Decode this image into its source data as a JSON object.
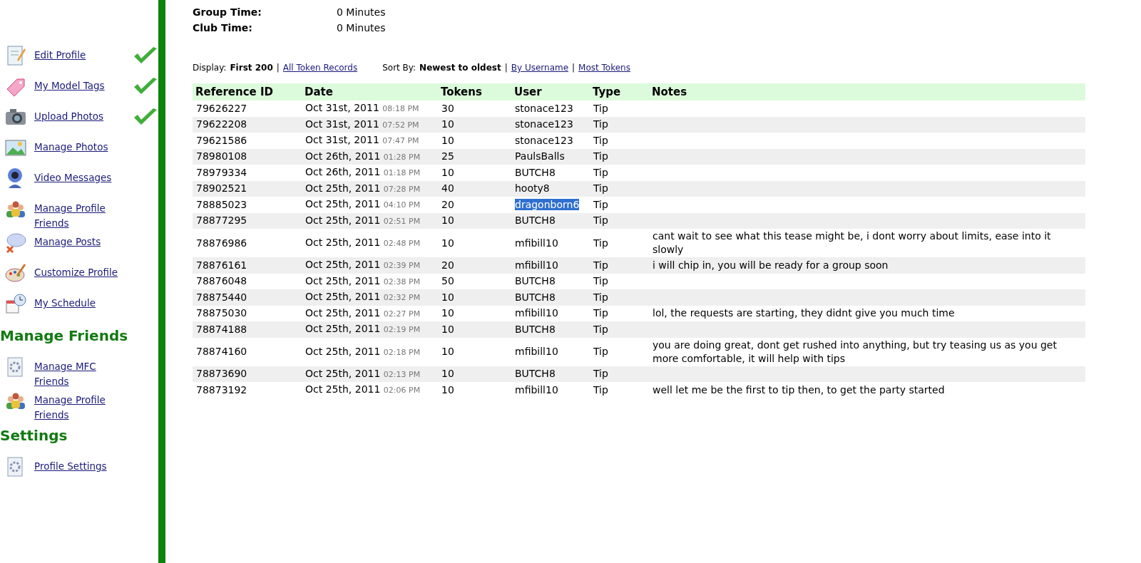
{
  "summary": [
    {
      "label": "Group Time:",
      "value": "0 Minutes"
    },
    {
      "label": "Club Time:",
      "value": "0 Minutes"
    }
  ],
  "sidebar": {
    "sections": [
      {
        "items": [
          {
            "label": "Edit Profile",
            "checked": true
          },
          {
            "label": "My Model Tags",
            "checked": true
          },
          {
            "label": "Upload Photos",
            "checked": true
          },
          {
            "label": "Manage Photos",
            "checked": false
          },
          {
            "label": "Video Messages",
            "checked": false
          },
          {
            "label": "Manage Profile Friends",
            "checked": false
          },
          {
            "label": "Manage Posts",
            "checked": false
          },
          {
            "label": "Customize Profile",
            "checked": false
          },
          {
            "label": "My Schedule",
            "checked": false
          }
        ]
      },
      {
        "heading": "Manage Friends",
        "items": [
          {
            "label": "Manage MFC Friends",
            "checked": false
          },
          {
            "label": "Manage Profile Friends",
            "checked": false
          }
        ]
      },
      {
        "heading": "Settings",
        "items": [
          {
            "label": "Profile Settings",
            "checked": false
          }
        ]
      }
    ]
  },
  "filters": {
    "separator": "|",
    "display_label": "Display:",
    "display_current": "First 200",
    "display_links": [
      "All Token Records"
    ],
    "sort_label": "Sort By:",
    "sort_current": "Newest to oldest",
    "sort_links": [
      "By Username",
      "Most Tokens"
    ]
  },
  "table": {
    "columns": [
      "Reference ID",
      "Date",
      "Tokens",
      "User",
      "Type",
      "Notes"
    ],
    "rows": [
      {
        "id": "79626227",
        "date": "Oct 31st, 2011",
        "time": "08:18 PM",
        "tokens": "30",
        "user": "stonace123",
        "type": "Tip",
        "selected": false
      },
      {
        "id": "79622208",
        "date": "Oct 31st, 2011",
        "time": "07:52 PM",
        "tokens": "10",
        "user": "stonace123",
        "type": "Tip",
        "selected": false
      },
      {
        "id": "79621586",
        "date": "Oct 31st, 2011",
        "time": "07:47 PM",
        "tokens": "10",
        "user": "stonace123",
        "type": "Tip",
        "selected": false
      },
      {
        "id": "78980108",
        "date": "Oct 26th, 2011",
        "time": "01:28 PM",
        "tokens": "25",
        "user": "PaulsBalls",
        "type": "Tip",
        "selected": false
      },
      {
        "id": "78979334",
        "date": "Oct 26th, 2011",
        "time": "01:18 PM",
        "tokens": "10",
        "user": "BUTCH8",
        "type": "Tip",
        "selected": false
      },
      {
        "id": "78902521",
        "date": "Oct 25th, 2011",
        "time": "07:28 PM",
        "tokens": "40",
        "user": "hooty8",
        "type": "Tip",
        "selected": false
      },
      {
        "id": "78885023",
        "date": "Oct 25th, 2011",
        "time": "04:10 PM",
        "tokens": "20",
        "user": "dragonborn6",
        "type": "Tip",
        "selected": true
      },
      {
        "id": "78877295",
        "date": "Oct 25th, 2011",
        "time": "02:51 PM",
        "tokens": "10",
        "user": "BUTCH8",
        "type": "Tip",
        "selected": false
      },
      {
        "id": "78876986",
        "date": "Oct 25th, 2011",
        "time": "02:48 PM",
        "tokens": "10",
        "user": "mfibill10",
        "type": "Tip",
        "notes": "cant wait to see what this tease might be, i dont worry about limits, ease into it slowly",
        "selected": false
      },
      {
        "id": "78876161",
        "date": "Oct 25th, 2011",
        "time": "02:39 PM",
        "tokens": "20",
        "user": "mfibill10",
        "type": "Tip",
        "notes": "i will chip in, you will be ready for a group soon",
        "selected": false
      },
      {
        "id": "78876048",
        "date": "Oct 25th, 2011",
        "time": "02:38 PM",
        "tokens": "50",
        "user": "BUTCH8",
        "type": "Tip",
        "selected": false
      },
      {
        "id": "78875440",
        "date": "Oct 25th, 2011",
        "time": "02:32 PM",
        "tokens": "10",
        "user": "BUTCH8",
        "type": "Tip",
        "selected": false
      },
      {
        "id": "78875030",
        "date": "Oct 25th, 2011",
        "time": "02:27 PM",
        "tokens": "10",
        "user": "mfibill10",
        "type": "Tip",
        "notes": "lol, the requests are starting, they didnt give you much time",
        "selected": false
      },
      {
        "id": "78874188",
        "date": "Oct 25th, 2011",
        "time": "02:19 PM",
        "tokens": "10",
        "user": "BUTCH8",
        "type": "Tip",
        "selected": false
      },
      {
        "id": "78874160",
        "date": "Oct 25th, 2011",
        "time": "02:18 PM",
        "tokens": "10",
        "user": "mfibill10",
        "type": "Tip",
        "notes": "you are doing great, dont get rushed into anything, but try teasing us as you get more comfortable, it will help with tips",
        "selected": false
      },
      {
        "id": "78873690",
        "date": "Oct 25th, 2011",
        "time": "02:13 PM",
        "tokens": "10",
        "user": "BUTCH8",
        "type": "Tip",
        "selected": false
      },
      {
        "id": "78873192",
        "date": "Oct 25th, 2011",
        "time": "02:06 PM",
        "tokens": "10",
        "user": "mfibill10",
        "type": "Tip",
        "notes": "well let me be the first to tip then, to get the party started",
        "selected": false
      }
    ]
  }
}
